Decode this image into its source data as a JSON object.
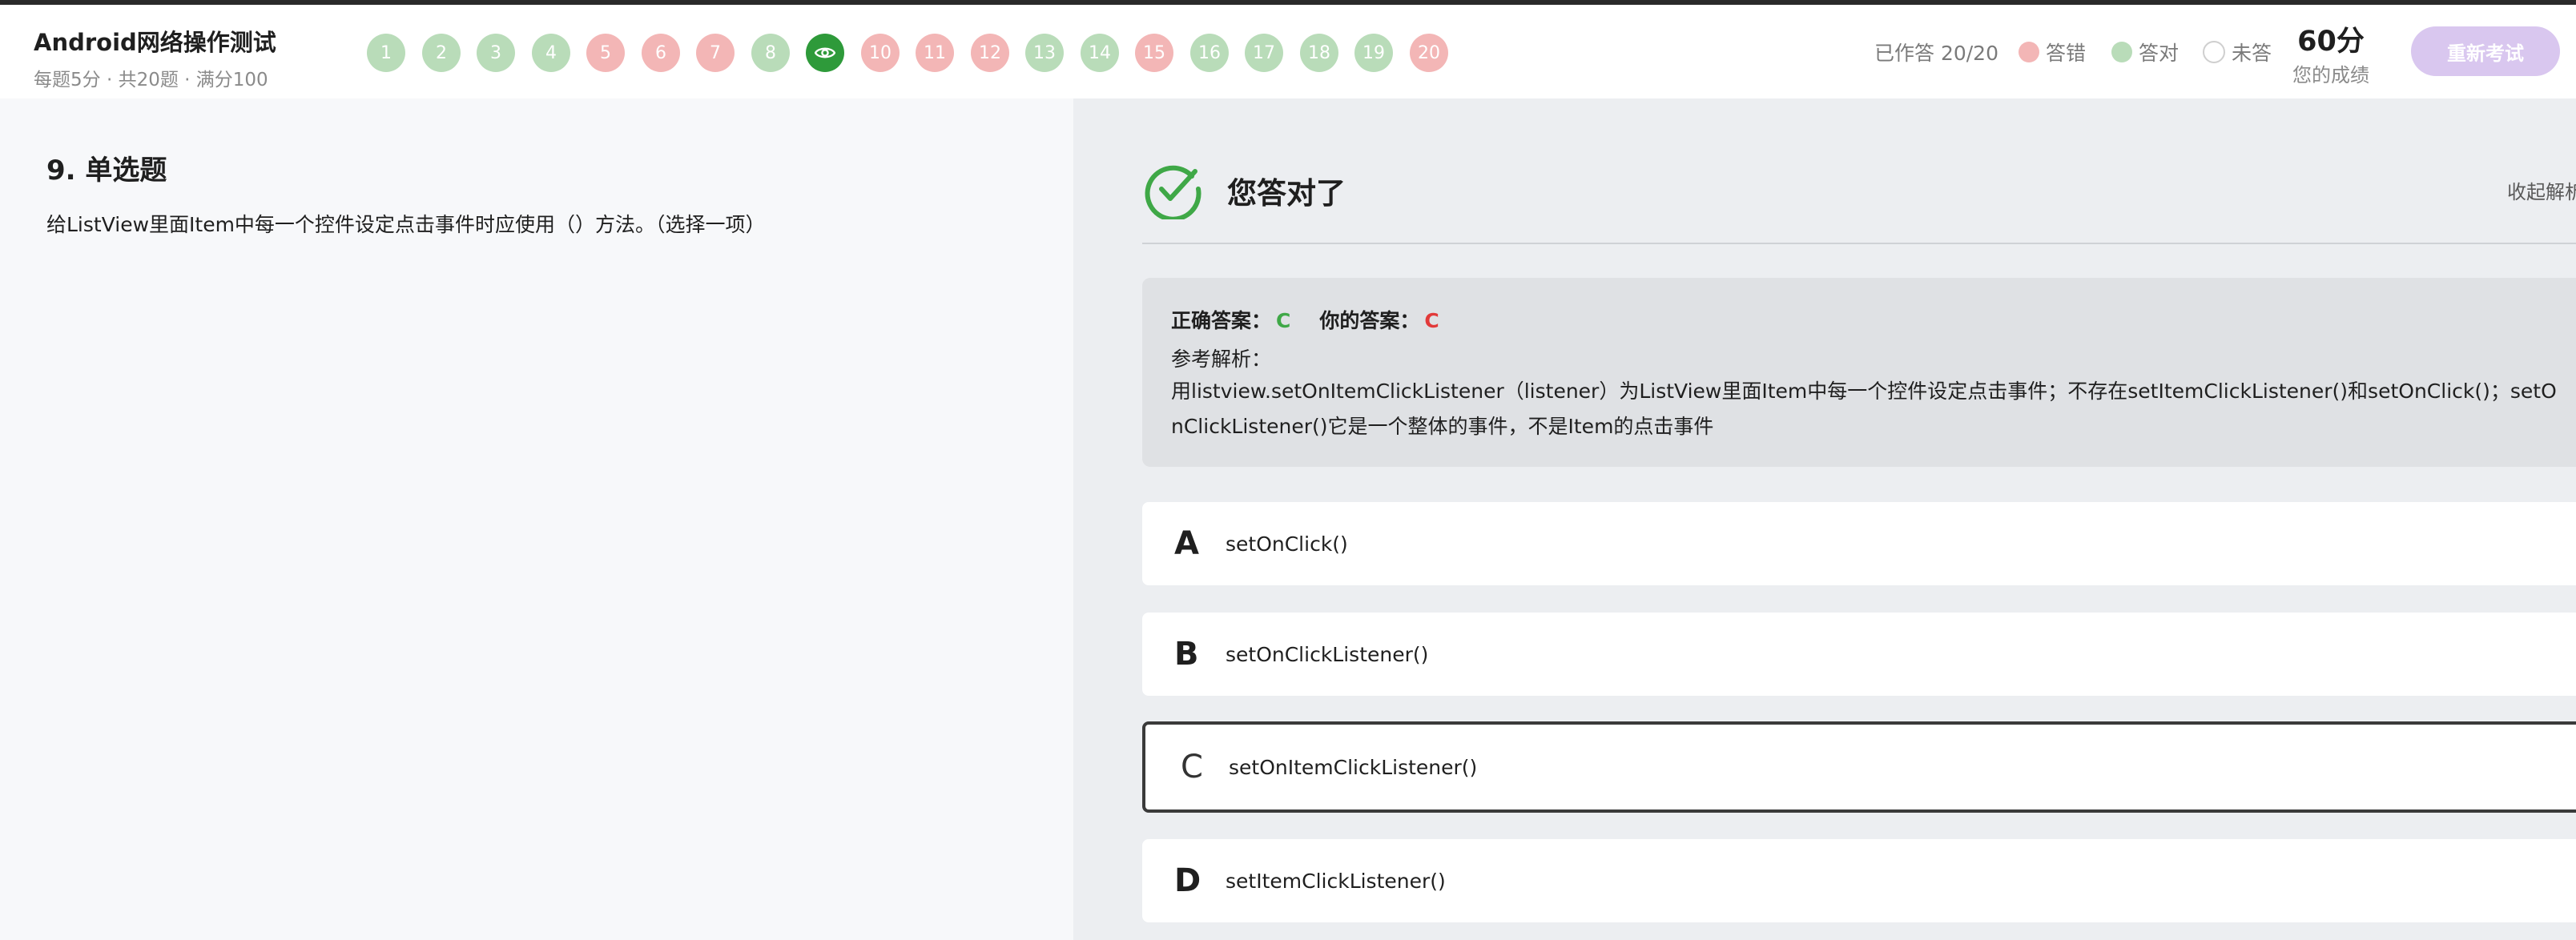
{
  "header": {
    "title": "Android网络操作测试",
    "subtitle": "每题5分 · 共20题 · 满分100",
    "questions": [
      {
        "label": "1",
        "status": "correct"
      },
      {
        "label": "2",
        "status": "correct"
      },
      {
        "label": "3",
        "status": "correct"
      },
      {
        "label": "4",
        "status": "correct"
      },
      {
        "label": "5",
        "status": "wrong"
      },
      {
        "label": "6",
        "status": "wrong"
      },
      {
        "label": "7",
        "status": "wrong"
      },
      {
        "label": "8",
        "status": "correct"
      },
      {
        "label": "",
        "status": "current",
        "icon": "eye-icon"
      },
      {
        "label": "10",
        "status": "wrong"
      },
      {
        "label": "11",
        "status": "wrong"
      },
      {
        "label": "12",
        "status": "wrong"
      },
      {
        "label": "13",
        "status": "correct"
      },
      {
        "label": "14",
        "status": "correct"
      },
      {
        "label": "15",
        "status": "wrong"
      },
      {
        "label": "16",
        "status": "correct"
      },
      {
        "label": "17",
        "status": "correct"
      },
      {
        "label": "18",
        "status": "correct"
      },
      {
        "label": "19",
        "status": "correct"
      },
      {
        "label": "20",
        "status": "wrong"
      }
    ],
    "answered": "已作答 20/20",
    "legend": {
      "wrong": "答错",
      "right": "答对",
      "none": "未答"
    },
    "score": "60分",
    "score_label": "您的成绩",
    "retry_label": "重新考试"
  },
  "question": {
    "heading": "9. 单选题",
    "text": "给ListView里面Item中每一个控件设定点击事件时应使用（）方法。（选择一项）"
  },
  "result": {
    "title": "您答对了",
    "collapse_label": "收起解析",
    "correct_label": "正确答案：",
    "correct_value": "C",
    "user_label": "你的答案：",
    "user_value": "C",
    "ref_label": "参考解析：",
    "ref_text": "用listview.setOnItemClickListener（listener）为ListView里面Item中每一个控件设定点击事件；不存在setItemClickListener()和setOnClick()；setOnClickListener()它是一个整体的事件，不是Item的点击事件"
  },
  "options": [
    {
      "letter": "A",
      "text": "setOnClick()"
    },
    {
      "letter": "B",
      "text": "setOnClickListener()"
    },
    {
      "letter": "C",
      "text": "setOnItemClickListener()"
    },
    {
      "letter": "D",
      "text": "setItemClickListener()"
    }
  ],
  "colors": {
    "correct": "#b9dcb9",
    "wrong": "#f3b6b6",
    "current": "#2e9a3a",
    "accent_purple": "#d9c7ef",
    "correct_text": "#3fa847",
    "user_text": "#e23a3a"
  }
}
